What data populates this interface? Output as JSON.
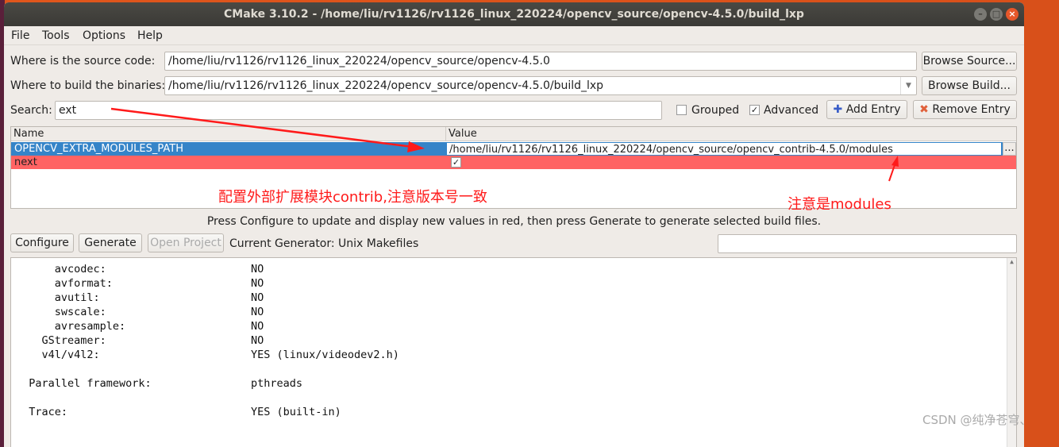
{
  "window": {
    "title": "CMake 3.10.2 - /home/liu/rv1126/rv1126_linux_220224/opencv_source/opencv-4.5.0/build_lxp"
  },
  "menu": [
    "File",
    "Tools",
    "Options",
    "Help"
  ],
  "source": {
    "label": "Where is the source code:",
    "value": "/home/liu/rv1126/rv1126_linux_220224/opencv_source/opencv-4.5.0",
    "button": "Browse Source..."
  },
  "build": {
    "label": "Where to build the binaries:",
    "value": "/home/liu/rv1126/rv1126_linux_220224/opencv_source/opencv-4.5.0/build_lxp",
    "button": "Browse Build..."
  },
  "search": {
    "label": "Search:",
    "value": "ext"
  },
  "options": {
    "grouped": {
      "label": "Grouped",
      "checked": false
    },
    "advanced": {
      "label": "Advanced",
      "checked": true
    },
    "add_entry": "Add Entry",
    "remove_entry": "Remove Entry"
  },
  "table": {
    "headers": [
      "Name",
      "Value"
    ],
    "rows": [
      {
        "name": "OPENCV_EXTRA_MODULES_PATH",
        "value": "/home/liu/rv1126/rv1126_linux_220224/opencv_source/opencv_contrib-4.5.0/modules",
        "browse": "...",
        "selected": true
      },
      {
        "name": "next",
        "value": "✓",
        "selected": false
      }
    ]
  },
  "status": "Press Configure to update and display new values in red, then press Generate to generate selected build files.",
  "actions": {
    "configure": "Configure",
    "generate": "Generate",
    "open_project": "Open Project",
    "generator": "Current Generator: Unix Makefiles"
  },
  "output": [
    {
      "k": "      avcodec:",
      "v": "NO"
    },
    {
      "k": "      avformat:",
      "v": "NO"
    },
    {
      "k": "      avutil:",
      "v": "NO"
    },
    {
      "k": "      swscale:",
      "v": "NO"
    },
    {
      "k": "      avresample:",
      "v": "NO"
    },
    {
      "k": "    GStreamer:",
      "v": "NO"
    },
    {
      "k": "    v4l/v4l2:",
      "v": "YES (linux/videodev2.h)"
    },
    {
      "k": "",
      "v": ""
    },
    {
      "k": "  Parallel framework:",
      "v": "pthreads"
    },
    {
      "k": "",
      "v": ""
    },
    {
      "k": "  Trace:",
      "v": "YES (built-in)"
    }
  ],
  "annotations": {
    "contrib": "配置外部扩展模块contrib,注意版本号一致",
    "modules": "注意是modules"
  },
  "watermark": "CSDN @纯净苍穹、",
  "colors": {
    "selected": "#3584c8",
    "changed": "#ff6363",
    "annotation": "#ff1a1a"
  }
}
